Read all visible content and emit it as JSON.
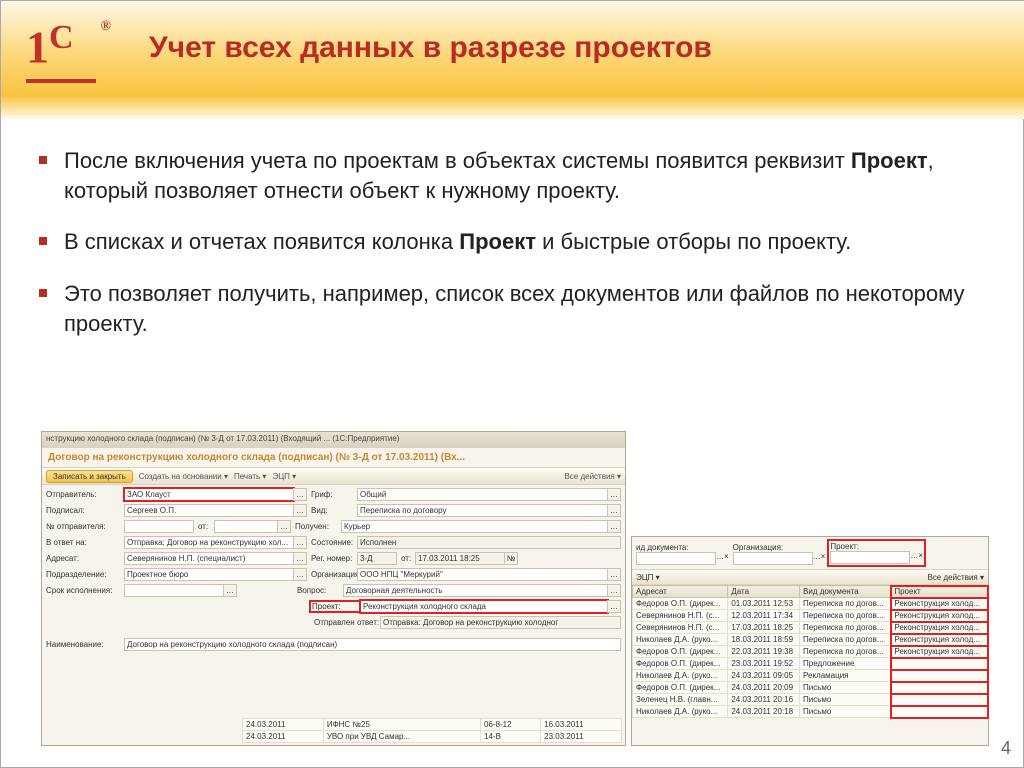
{
  "slide": {
    "title": "Учет всех данных в разрезе проектов",
    "page_number": "4"
  },
  "bullets": {
    "b1_pre": "После включения учета по проектам в объектах системы появится реквизит ",
    "b1_bold": "Проект",
    "b1_post": ", который позволяет отнести объект к нужному проекту.",
    "b2_pre": "В списках и отчетах появится колонка ",
    "b2_bold": "Проект",
    "b2_post": " и быстрые отборы по проекту.",
    "b3": "Это позволяет получить, например, список всех документов или файлов по некоторому проекту."
  },
  "win1": {
    "titlebar": "нструкцию холодного склада (подписан) (№ 3-Д от 17.03.2011) (Входящий ... (1С:Предприятие)",
    "doc_title": "Договор на реконструкцию холодного склада (подписан) (№ 3-Д от 17.03.2011) (Вх...",
    "toolbar": {
      "save": "Записать и закрыть",
      "create": "Создать на основании ▾",
      "print": "Печать ▾",
      "ecp": "ЭЦП ▾",
      "actions": "Все действия ▾"
    },
    "form": {
      "sender_lbl": "Отправитель:",
      "sender": "ЗАО Клауст",
      "signed_lbl": "Подписал:",
      "signed": "Сергеев О.П.",
      "sender_no_lbl": "№ отправителя:",
      "sender_no": "",
      "ot_lbl": "от:",
      "reply_to_lbl": "В ответ на:",
      "reply_to": "Отправка: Договор на реконструкцию хол...",
      "addressee_lbl": "Адресат:",
      "addressee": "Северянинов Н.П. (специалист)",
      "dept_lbl": "Подразделение:",
      "dept": "Проектное бюро",
      "deadline_lbl": "Срок исполнения:",
      "deadline": "",
      "grif_lbl": "Гриф:",
      "grif": "Общий",
      "vid_lbl": "Вид:",
      "vid": "Переписка по договору",
      "received_lbl": "Получен:",
      "received": "Курьер",
      "state_lbl": "Состояние:",
      "state": "Исполнен",
      "regno_lbl": "Рег. номер:",
      "regno": "3-Д",
      "regno_ot_lbl": "от:",
      "regno_ot": "17.03.2011 18:25",
      "org_lbl": "Организация:",
      "org": "ООО НПЦ \"Меркурий\"",
      "question_lbl": "Вопрос:",
      "question": "Договорная деятельность",
      "project_lbl": "Проект:",
      "project": "Реконструкция холодного склада",
      "sent_reply_lbl": "Отправлен ответ:",
      "sent_reply": "Отправка: Договор на реконструкцию холодног",
      "name_lbl": "Наименование:",
      "name": "Договор на реконструкцию холодного склада (подписан)"
    },
    "lower_rows": [
      {
        "c1": "24.03.2011",
        "c2": "ИФНС №25",
        "c3": "06-8-12",
        "c4": "16.03.2011"
      },
      {
        "c1": "24.03.2011",
        "c2": "УВО при УВД Самар...",
        "c3": "14-В",
        "c4": "23.03.2011"
      }
    ]
  },
  "win2": {
    "filters": {
      "viddoc_lbl": "ид документа:",
      "org_lbl": "Организация:",
      "project_lbl": "Проект:"
    },
    "toolbar": {
      "ecp": "ЭЦП ▾",
      "actions": "Все действия ▾"
    },
    "headers": {
      "addr": "Адресат",
      "date": "Дата",
      "vid": "Вид документа",
      "proj": "Проект"
    },
    "rows": [
      {
        "addr": "Федоров О.П. (дирек...",
        "date": "01.03.2011 12:53",
        "vid": "Переписка по догов...",
        "proj": "Реконструкция холод..."
      },
      {
        "addr": "Северянинов Н.П. (с...",
        "date": "12.03.2011 17:34",
        "vid": "Переписка по догов...",
        "proj": "Реконструкция холод..."
      },
      {
        "addr": "Северянинов Н.П. (с...",
        "date": "17.03.2011 18:25",
        "vid": "Переписка по догов...",
        "proj": "Реконструкция холод..."
      },
      {
        "addr": "Николаев Д.А. (руко...",
        "date": "18.03.2011 18:59",
        "vid": "Переписка по догов...",
        "proj": "Реконструкция холод..."
      },
      {
        "addr": "Федоров О.П. (дирек...",
        "date": "22.03.2011 19:38",
        "vid": "Переписка по догов...",
        "proj": "Реконструкция холод..."
      },
      {
        "addr": "Федоров О.П. (дирек...",
        "date": "23.03.2011 19:52",
        "vid": "Предложение",
        "proj": ""
      },
      {
        "addr": "Николаев Д.А. (руко...",
        "date": "24.03.2011 09:05",
        "vid": "Рекламация",
        "proj": ""
      },
      {
        "addr": "Федоров О.П. (дирек...",
        "date": "24.03.2011 20:09",
        "vid": "Письмо",
        "proj": ""
      },
      {
        "addr": "Зеленец Н.В. (главн...",
        "date": "24.03.2011 20:16",
        "vid": "Письмо",
        "proj": ""
      },
      {
        "addr": "Николаев Д.А. (руко...",
        "date": "24.03.2011 20:18",
        "vid": "Письмо",
        "proj": ""
      }
    ]
  }
}
